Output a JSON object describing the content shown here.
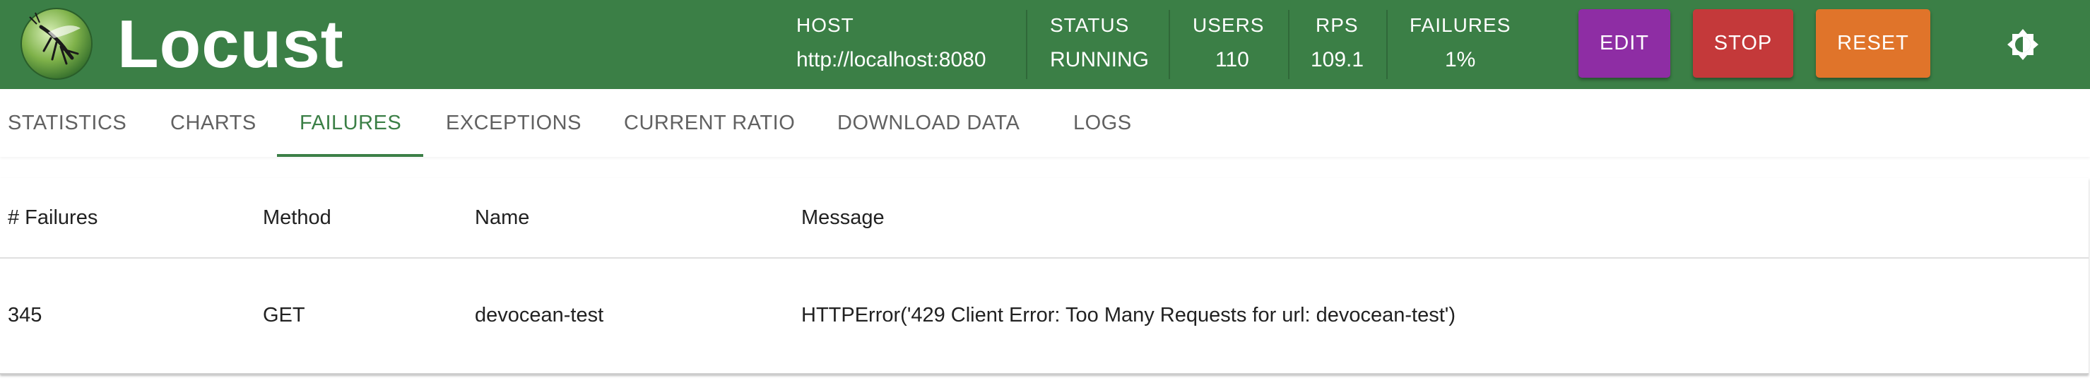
{
  "header": {
    "brand": "Locust",
    "stats": {
      "host": {
        "label": "HOST",
        "value": "http://localhost:8080"
      },
      "status": {
        "label": "STATUS",
        "value": "RUNNING"
      },
      "users": {
        "label": "USERS",
        "value": "110"
      },
      "rps": {
        "label": "RPS",
        "value": "109.1"
      },
      "failures": {
        "label": "FAILURES",
        "value": "1%"
      }
    },
    "buttons": {
      "edit": "EDIT",
      "stop": "STOP",
      "reset": "RESET"
    },
    "colors": {
      "header_bg": "#3b7f46",
      "edit": "#8e2da4",
      "stop": "#c4393a",
      "reset": "#e0742a"
    },
    "theme_toggle_icon": "brightness-icon"
  },
  "tabs": {
    "items": [
      {
        "label": "STATISTICS"
      },
      {
        "label": "CHARTS"
      },
      {
        "label": "FAILURES"
      },
      {
        "label": "EXCEPTIONS"
      },
      {
        "label": "CURRENT RATIO"
      },
      {
        "label": "DOWNLOAD DATA"
      },
      {
        "label": "LOGS"
      }
    ],
    "active": "FAILURES"
  },
  "failures_table": {
    "columns": [
      "# Failures",
      "Method",
      "Name",
      "Message"
    ],
    "rows": [
      [
        "345",
        "GET",
        "devocean-test",
        "HTTPError('429 Client Error: Too Many Requests for url: devocean-test')"
      ]
    ]
  }
}
